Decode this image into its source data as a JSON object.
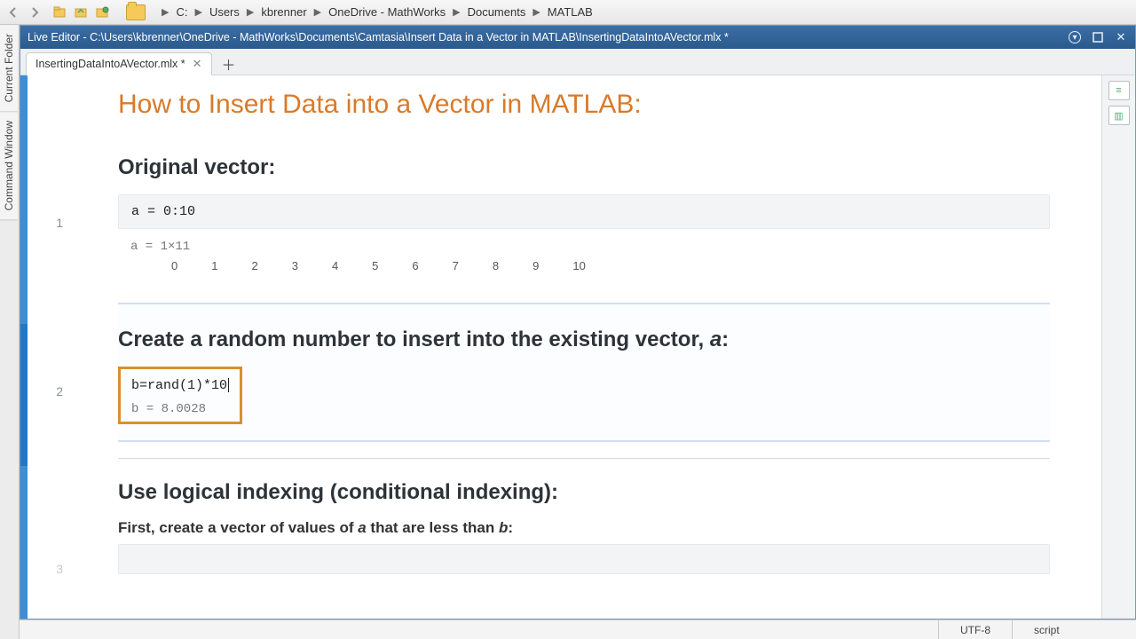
{
  "breadcrumb": [
    "C:",
    "Users",
    "kbrenner",
    "OneDrive - MathWorks",
    "Documents",
    "MATLAB"
  ],
  "leftTabs": [
    "Current Folder",
    "Command Window"
  ],
  "titlebar": "Live Editor - C:\\Users\\kbrenner\\OneDrive - MathWorks\\Documents\\Camtasia\\Insert Data in a Vector in MATLAB\\InsertingDataIntoAVector.mlx *",
  "tab": {
    "label": "InsertingDataIntoAVector.mlx *"
  },
  "doc": {
    "title": "How to Insert Data into a Vector in MATLAB:",
    "sec1_heading": "Original vector:",
    "sec1_code": "a = 0:10",
    "sec1_out_header": "a = 1×11",
    "sec1_out_values": [
      "0",
      "1",
      "2",
      "3",
      "4",
      "5",
      "6",
      "7",
      "8",
      "9",
      "10"
    ],
    "sec2_heading_pre": "Create a random number to insert into the existing vector, ",
    "sec2_heading_var": "a",
    "sec2_heading_post": ":",
    "sec2_code": "b=rand(1)*10",
    "sec2_out": "b = 8.0028",
    "sec3_heading": "Use logical indexing (conditional indexing):",
    "sec3_sub_pre": "First, create a vector of values of ",
    "sec3_sub_var1": "a",
    "sec3_sub_mid": " that are less than ",
    "sec3_sub_var2": "b",
    "sec3_sub_post": ":"
  },
  "lineNumbers": {
    "l1": "1",
    "l2": "2",
    "l3": "3"
  },
  "status": {
    "encoding": "UTF-8",
    "mode": "script"
  }
}
